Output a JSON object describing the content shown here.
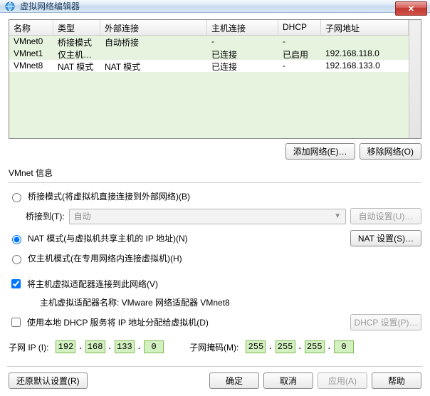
{
  "window": {
    "title": "虚拟网络编辑器"
  },
  "grid": {
    "headers": [
      "名称",
      "类型",
      "外部连接",
      "主机连接",
      "DHCP",
      "子网地址"
    ],
    "rows": [
      {
        "name": "VMnet0",
        "type": "桥接模式",
        "ext": "自动桥接",
        "host": "-",
        "dhcp": "-",
        "subnet": ""
      },
      {
        "name": "VMnet1",
        "type": "仅主机…",
        "ext": "",
        "host": "已连接",
        "dhcp": "已启用",
        "subnet": "192.168.118.0"
      },
      {
        "name": "VMnet8",
        "type": "NAT 模式",
        "ext": "NAT 模式",
        "host": "已连接",
        "dhcp": "-",
        "subnet": "192.168.133.0"
      }
    ],
    "selected_index": 2
  },
  "buttons": {
    "add_net": "添加网络(E)…",
    "remove_net": "移除网络(O)",
    "auto_set": "自动设置(U)…",
    "nat_set": "NAT 设置(S)…",
    "dhcp_set": "DHCP 设置(P)…",
    "restore": "还原默认设置(R)",
    "ok": "确定",
    "cancel": "取消",
    "apply": "应用(A)",
    "help": "帮助"
  },
  "info": {
    "section": "VMnet 信息",
    "bridged": "桥接模式(将虚拟机直接连接到外部网络)(B)",
    "bridged_to_label": "桥接到(T):",
    "bridged_to_value": "自动",
    "nat": "NAT 模式(与虚拟机共享主机的 IP 地址)(N)",
    "hostonly": "仅主机模式(在专用网络内连接虚拟机)(H)",
    "connect_adapter": "将主机虚拟适配器连接到此网络(V)",
    "adapter_name_label": "主机虚拟适配器名称: VMware 网络适配器 VMnet8",
    "use_dhcp": "使用本地 DHCP 服务将 IP 地址分配给虚拟机(D)",
    "subnet_ip_label": "子网 IP (I):",
    "subnet_mask_label": "子网掩码(M):",
    "subnet_ip": [
      "192",
      "168",
      "133",
      "0"
    ],
    "subnet_mask": [
      "255",
      "255",
      "255",
      "0"
    ]
  },
  "state": {
    "mode": "nat",
    "connect_adapter_checked": true,
    "use_dhcp_checked": false
  }
}
